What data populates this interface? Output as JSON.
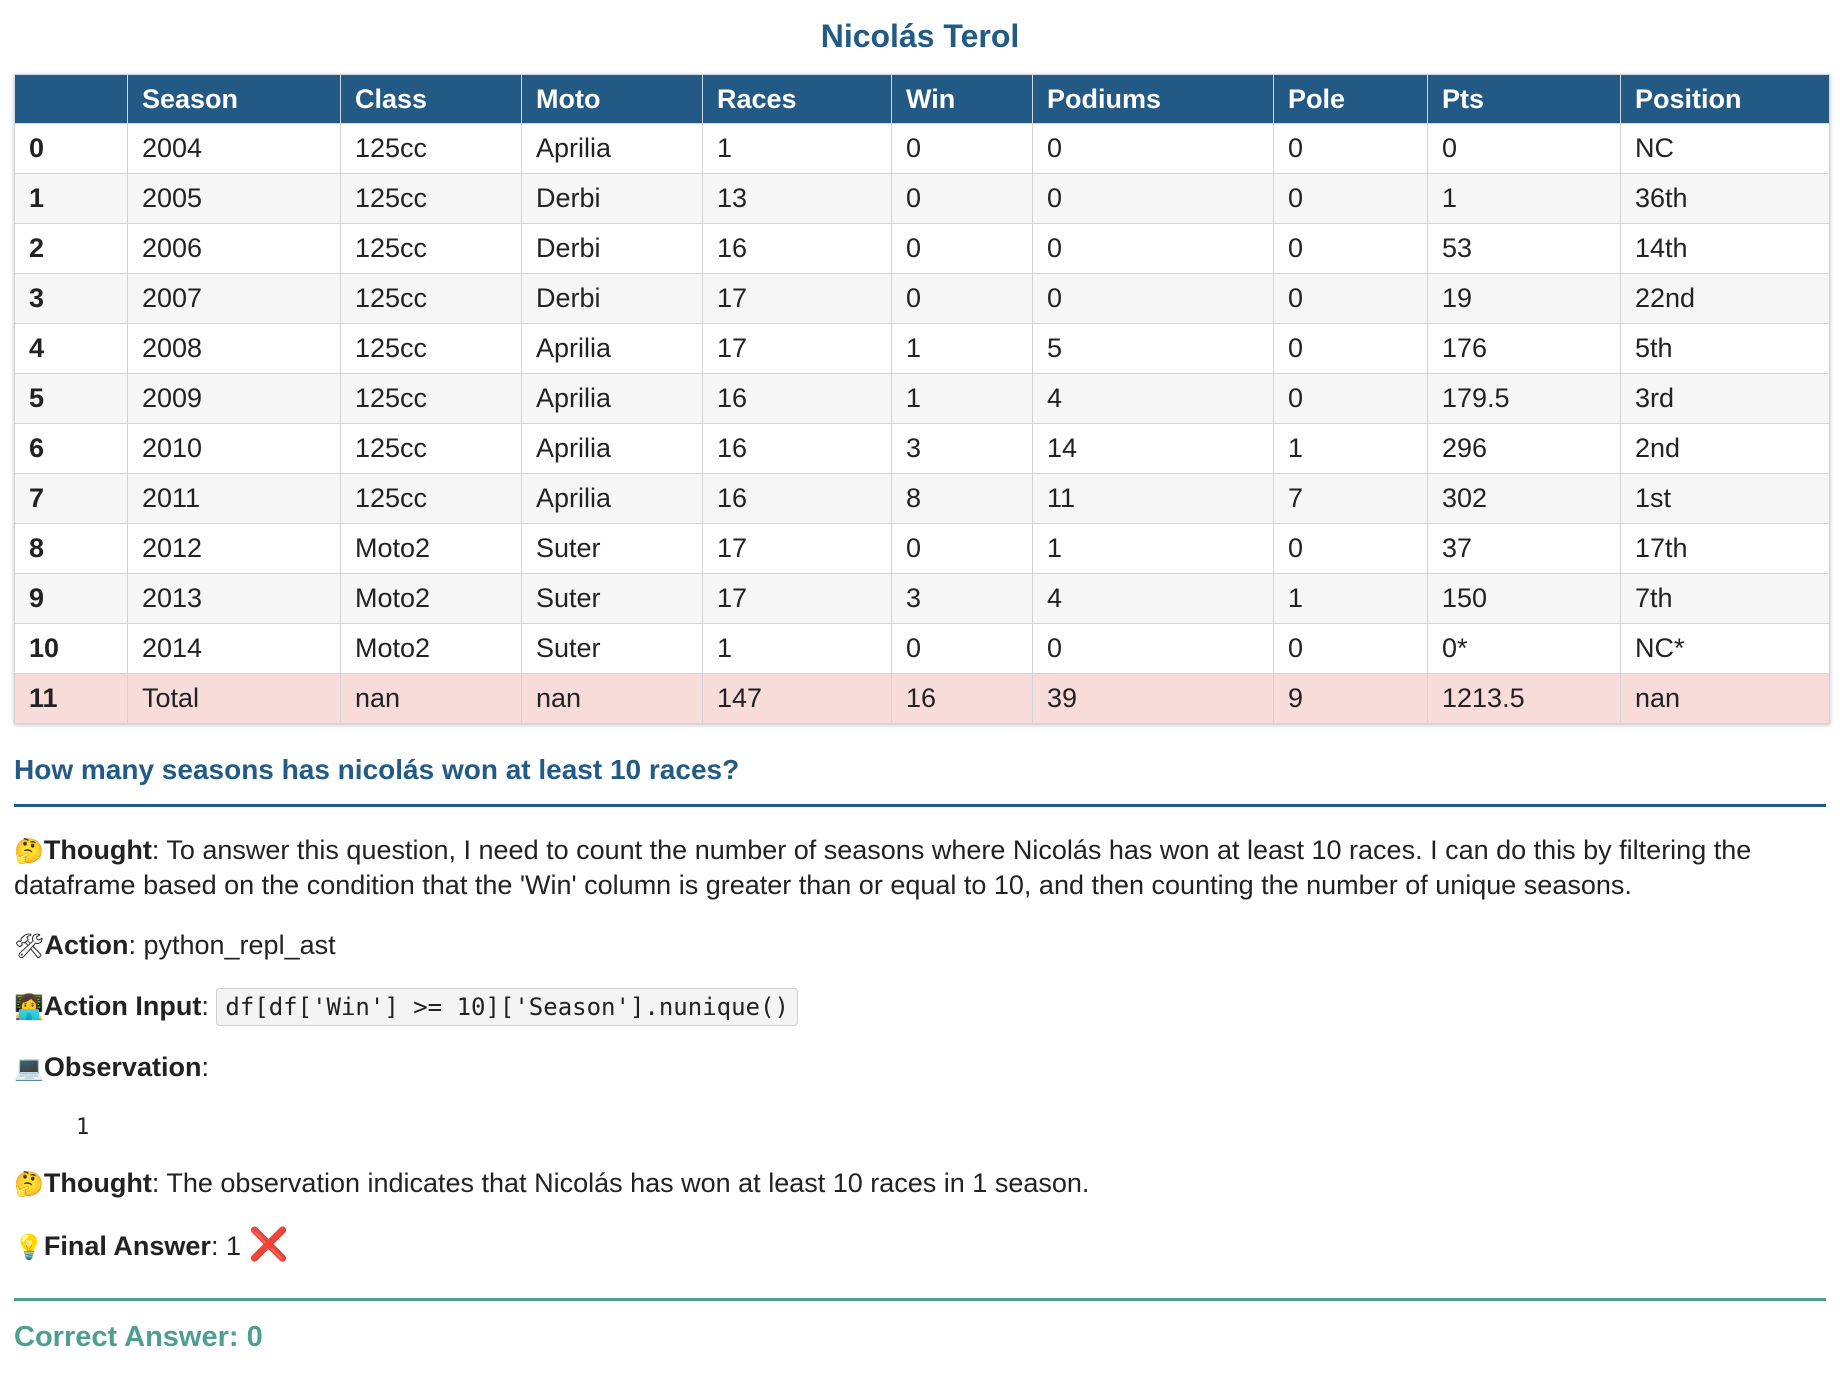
{
  "title": "Nicolás Terol",
  "table": {
    "headers": [
      "",
      "Season",
      "Class",
      "Moto",
      "Races",
      "Win",
      "Podiums",
      "Pole",
      "Pts",
      "Position"
    ],
    "rows": [
      [
        "0",
        "2004",
        "125cc",
        "Aprilia",
        "1",
        "0",
        "0",
        "0",
        "0",
        "NC"
      ],
      [
        "1",
        "2005",
        "125cc",
        "Derbi",
        "13",
        "0",
        "0",
        "0",
        "1",
        "36th"
      ],
      [
        "2",
        "2006",
        "125cc",
        "Derbi",
        "16",
        "0",
        "0",
        "0",
        "53",
        "14th"
      ],
      [
        "3",
        "2007",
        "125cc",
        "Derbi",
        "17",
        "0",
        "0",
        "0",
        "19",
        "22nd"
      ],
      [
        "4",
        "2008",
        "125cc",
        "Aprilia",
        "17",
        "1",
        "5",
        "0",
        "176",
        "5th"
      ],
      [
        "5",
        "2009",
        "125cc",
        "Aprilia",
        "16",
        "1",
        "4",
        "0",
        "179.5",
        "3rd"
      ],
      [
        "6",
        "2010",
        "125cc",
        "Aprilia",
        "16",
        "3",
        "14",
        "1",
        "296",
        "2nd"
      ],
      [
        "7",
        "2011",
        "125cc",
        "Aprilia",
        "16",
        "8",
        "11",
        "7",
        "302",
        "1st"
      ],
      [
        "8",
        "2012",
        "Moto2",
        "Suter",
        "17",
        "0",
        "1",
        "0",
        "37",
        "17th"
      ],
      [
        "9",
        "2013",
        "Moto2",
        "Suter",
        "17",
        "3",
        "4",
        "1",
        "150",
        "7th"
      ],
      [
        "10",
        "2014",
        "Moto2",
        "Suter",
        "1",
        "0",
        "0",
        "0",
        "0*",
        "NC*"
      ],
      [
        "11",
        "Total",
        "nan",
        "nan",
        "147",
        "16",
        "39",
        "9",
        "1213.5",
        "nan"
      ]
    ],
    "highlight_color": "#f7dcd9",
    "header_color": "#235a85"
  },
  "question": "How many seasons has nicolás won at least 10 races?",
  "steps": {
    "thought1_emoji": "🤔",
    "thought1_label": "Thought",
    "thought1_text": ": To answer this question, I need to count the number of seasons where Nicolás has won at least 10 races. I can do this by filtering the dataframe based on the condition that the 'Win' column is greater than or equal to 10, and then counting the number of unique seasons.",
    "action_emoji": "🛠",
    "action_label": "Action",
    "action_text": ": python_repl_ast",
    "action_input_emoji": "👩‍💻",
    "action_input_label": "Action Input",
    "action_input_code": "df[df['Win'] >= 10]['Season'].nunique()",
    "observation_emoji": "💻",
    "observation_label": "Observation",
    "observation_output": "1",
    "thought2_emoji": "🤔",
    "thought2_label": "Thought",
    "thought2_text": ": The observation indicates that Nicolás has won at least 10 races in 1 season.",
    "final_emoji": "💡",
    "final_label": "Final Answer",
    "final_text": ": 1",
    "final_mark": "❌"
  },
  "correct_answer": "Correct Answer: 0"
}
